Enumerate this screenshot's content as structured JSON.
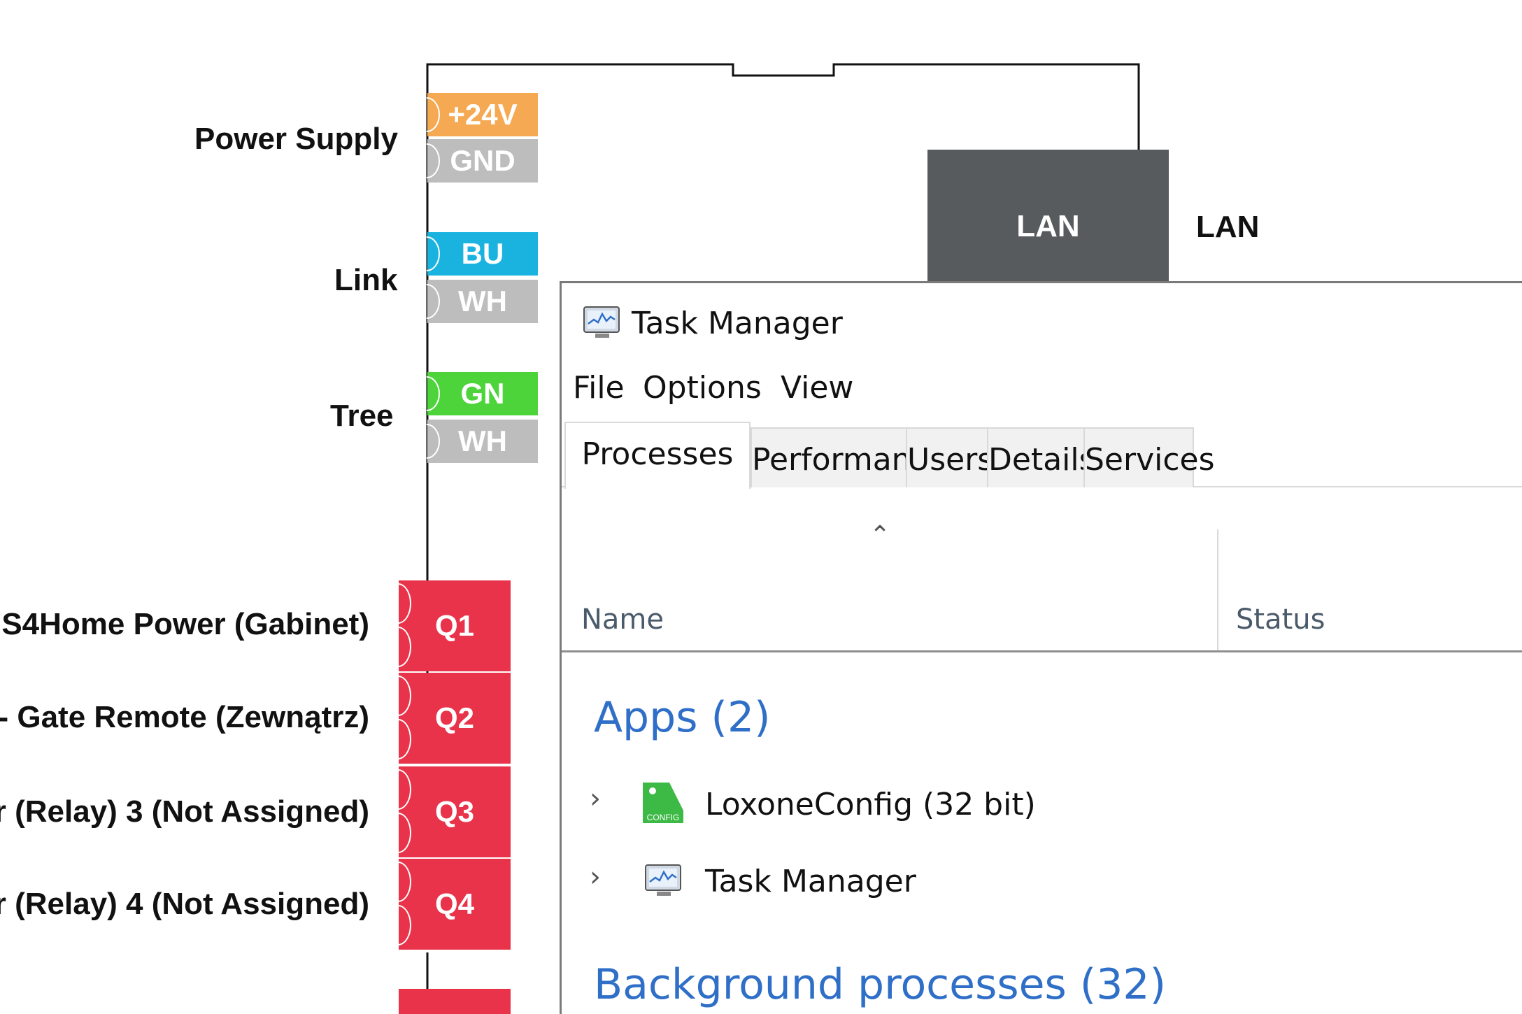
{
  "diagram": {
    "terminals": [
      {
        "label": "+24V",
        "color": "#f5a952"
      },
      {
        "label": "GND",
        "color": "#bdbdbd"
      },
      {
        "label": "BU",
        "color": "#1ab3e0"
      },
      {
        "label": "WH",
        "color": "#bdbdbd"
      },
      {
        "label": "GN",
        "color": "#4cd43a"
      },
      {
        "label": "WH",
        "color": "#bdbdbd"
      }
    ],
    "group_labels": [
      "Power Supply",
      "Link",
      "Tree"
    ],
    "relays": [
      {
        "label": "Q1",
        "name": "S4Home Power (Gabinet)"
      },
      {
        "label": "Q2",
        "name": "- Gate Remote (Zewnątrz)"
      },
      {
        "label": "Q3",
        "name": "r (Relay) 3 (Not Assigned)"
      },
      {
        "label": "Q4",
        "name": "r (Relay) 4 (Not Assigned)"
      }
    ],
    "relay_color": "#e8334a",
    "lan_box_label": "LAN",
    "lan_label": "LAN"
  },
  "task_manager": {
    "title": "Task Manager",
    "menu": [
      "File",
      "Options",
      "View"
    ],
    "tabs": [
      "Processes",
      "Performance",
      "Users",
      "Details",
      "Services"
    ],
    "active_tab": "Processes",
    "columns": {
      "name": "Name",
      "status": "Status"
    },
    "groups": {
      "apps": "Apps (2)",
      "background": "Background processes (32)"
    },
    "apps": [
      {
        "name": "LoxoneConfig (32 bit)",
        "icon": "loxone-config-icon"
      },
      {
        "name": "Task Manager",
        "icon": "task-manager-icon"
      }
    ],
    "config_icon_text": "CONFIG"
  }
}
